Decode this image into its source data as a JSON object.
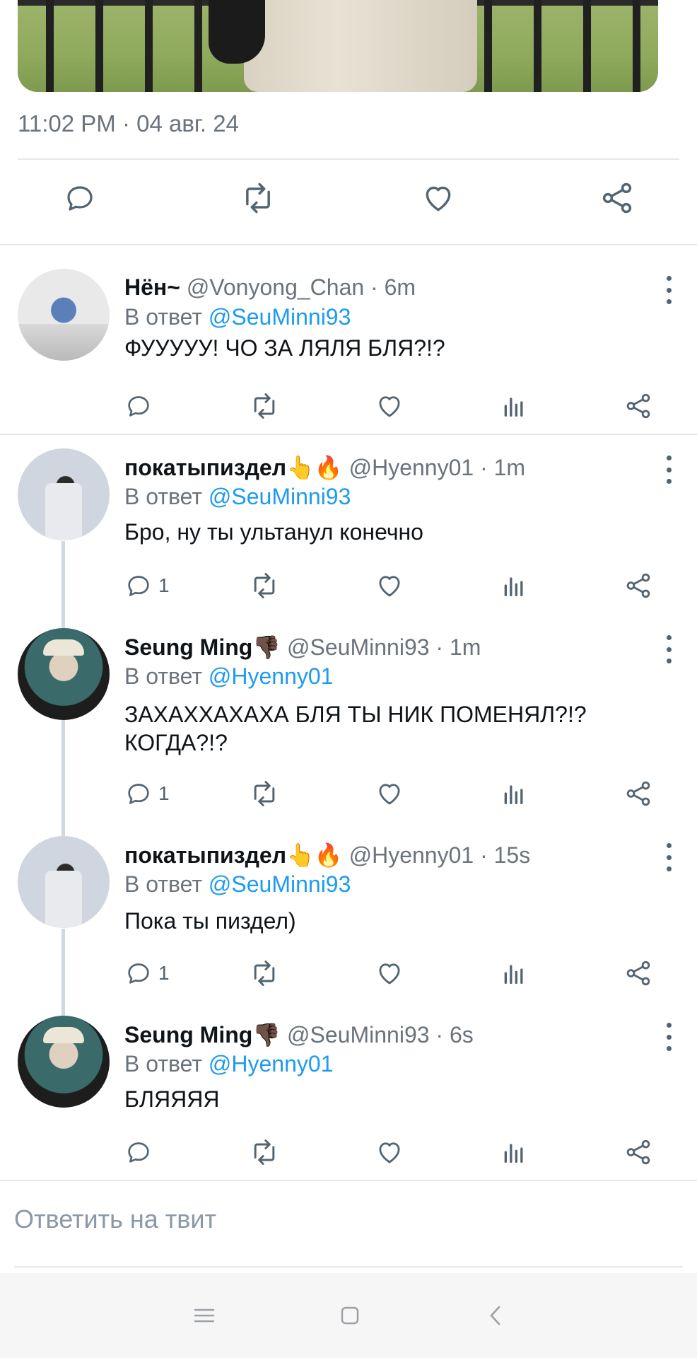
{
  "main_tweet": {
    "timestamp": "11:02 PM · 04 авг. 24"
  },
  "replies": [
    {
      "name": "Нён~",
      "handle": "@Vonyong_Chan · 6m",
      "reply_prefix": "В ответ",
      "reply_to": "@SeuMinni93",
      "text": "ФУУУУУ! ЧО ЗА ЛЯЛЯ БЛЯ?!?",
      "reply_count": ""
    },
    {
      "name": "покатыпиздел👆🔥",
      "handle": "@Hyenny01 · 1m",
      "reply_prefix": "В ответ",
      "reply_to": "@SeuMinni93",
      "text": "Бро, ну ты ультанул конечно",
      "reply_count": "1"
    },
    {
      "name": "Seung Ming👎🏿",
      "handle": "@SeuMinni93 · 1m",
      "reply_prefix": "В ответ",
      "reply_to": "@Hyenny01",
      "text": "ЗАХАХХАХАХА БЛЯ ТЫ НИК ПОМЕНЯЛ?!? КОГДА?!?",
      "reply_count": "1"
    },
    {
      "name": "покатыпиздел👆🔥",
      "handle": "@Hyenny01 · 15s",
      "reply_prefix": "В ответ",
      "reply_to": "@SeuMinni93",
      "text": "Пока ты пиздел)",
      "reply_count": "1"
    },
    {
      "name": "Seung Ming👎🏿",
      "handle": "@SeuMinni93 · 6s",
      "reply_prefix": "В ответ",
      "reply_to": "@Hyenny01",
      "text": "БЛЯЯЯЯ",
      "reply_count": ""
    }
  ],
  "compose": {
    "placeholder": "Ответить на твит"
  },
  "icons": {
    "reply": "reply-icon",
    "retweet": "retweet-icon",
    "like": "like-icon",
    "views": "views-icon",
    "share": "share-icon",
    "more": "more-icon"
  },
  "colors": {
    "mention": "#1d9bf0",
    "secondary_text": "#6a737d",
    "icon": "#536471"
  }
}
